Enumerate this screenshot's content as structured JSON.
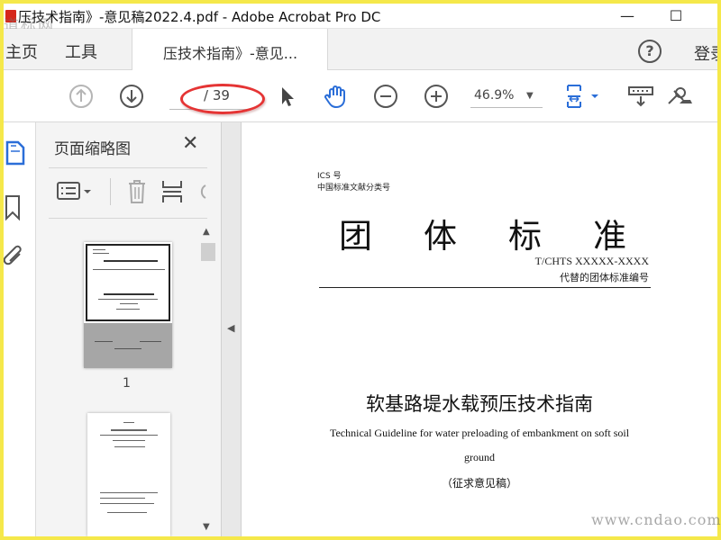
{
  "window": {
    "title": "压技术指南》-意见稿2022.4.pdf - Adobe Acrobat Pro DC",
    "controls": {
      "minimize": "—",
      "maximize": "☐"
    }
  },
  "watermarks": {
    "top_left": "道标网",
    "bottom_right": "www.cndao.com"
  },
  "tabs": {
    "home": "主页",
    "tools": "工具",
    "document": "压技术指南》-意见...",
    "help": "?",
    "login": "登录"
  },
  "toolbar": {
    "current_page": "",
    "page_total": "/ 39",
    "zoom": "46.9%",
    "icons": [
      "arrow-up-circle-icon",
      "arrow-down-circle-icon",
      "pointer-icon",
      "hand-icon",
      "zoom-out-icon",
      "zoom-in-icon",
      "page-fit-icon",
      "scroll-mode-icon",
      "sign-icon"
    ]
  },
  "sidebar": {
    "title": "页面缩略图",
    "close": "✕",
    "thumbnails": [
      {
        "label": "1"
      }
    ]
  },
  "document": {
    "ics": "ICS 号",
    "class_no": "中国标准文献分类号",
    "header_chars": [
      "团",
      "体",
      "标",
      "准"
    ],
    "code": "T/CHTS XXXXX-XXXX",
    "replaces": "代替的团体标准编号",
    "title_cn": "软基路堤水载预压技术指南",
    "title_en_line1": "Technical Guideline for water preloading of embankment on soft soil",
    "title_en_line2": "ground",
    "draft": "（征求意见稿）"
  },
  "colors": {
    "annotation": "#e53434",
    "accent": "#2b6ed8",
    "page_bg": "#f5e84a"
  }
}
